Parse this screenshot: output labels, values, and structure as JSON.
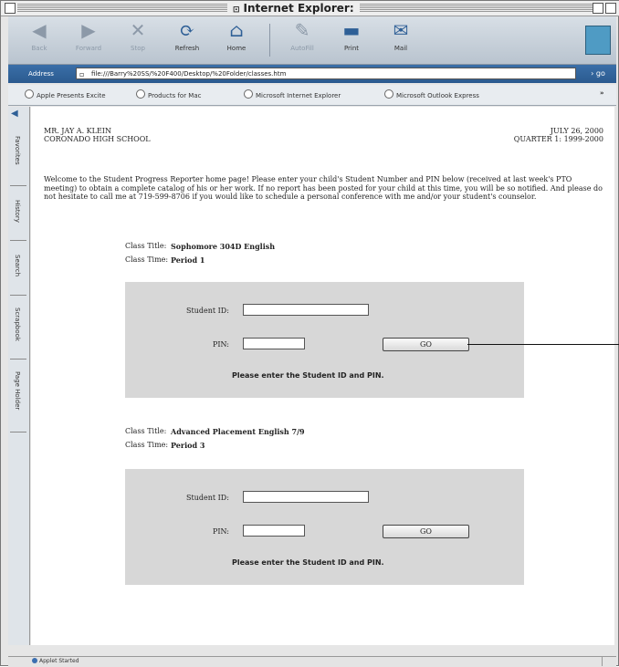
{
  "window": {
    "title": "Internet Explorer"
  },
  "toolbar": {
    "buttons": [
      {
        "label": "Back"
      },
      {
        "label": "Forward"
      },
      {
        "label": "Stop"
      },
      {
        "label": "Refresh"
      },
      {
        "label": "Home"
      },
      {
        "label": "AutoFill"
      },
      {
        "label": "Print"
      },
      {
        "label": "Mail"
      }
    ]
  },
  "address": {
    "label": "Address",
    "url": "file:///Barry%20SS/%20F400/Desktop/%20Folder/classes.htm",
    "go": "go"
  },
  "favorites": [
    {
      "label": "Apple Presents Excite"
    },
    {
      "label": "Products for Mac"
    },
    {
      "label": "Microsoft Internet Explorer"
    },
    {
      "label": "Microsoft Outlook Express"
    }
  ],
  "sidebar_tabs": [
    {
      "label": "Favorites"
    },
    {
      "label": "History"
    },
    {
      "label": "Search"
    },
    {
      "label": "Scrapbook"
    },
    {
      "label": "Page Holder"
    }
  ],
  "page": {
    "teacher_name": "MR. JAY A. KLEIN",
    "school": "CORONADO HIGH SCHOOL",
    "date": "JULY 26, 2000",
    "quarter": "QUARTER 1: 1999-2000",
    "intro": "Welcome to the Student Progress Reporter home page!  Please enter your child's Student Number and PIN below (received at last week's PTO meeting) to obtain a complete catalog of his or her work.   If no report has been posted for your child at this time, you will be so notified.  And please do not hesitate to call me at 719-599-8706 if you would like to schedule a personal conference with me and/or your student's counselor.",
    "classes": [
      {
        "title_label": "Class Title:",
        "title": "Sophomore 304D English",
        "time_label": "Class Time:",
        "time": "Period 1",
        "student_id_label": "Student ID:",
        "pin_label": "PIN:",
        "student_id_value": "",
        "pin_value": "",
        "go_label": "GO",
        "message": "Please enter the Student ID and PIN."
      },
      {
        "title_label": "Class Title:",
        "title": "Advanced Placement English 7/9",
        "time_label": "Class Time:",
        "time": "Period 3",
        "student_id_label": "Student ID:",
        "pin_label": "PIN:",
        "student_id_value": "",
        "pin_value": "",
        "go_label": "GO",
        "message": "Please enter the Student ID and PIN."
      }
    ]
  },
  "status": {
    "text": "Applet Started"
  }
}
